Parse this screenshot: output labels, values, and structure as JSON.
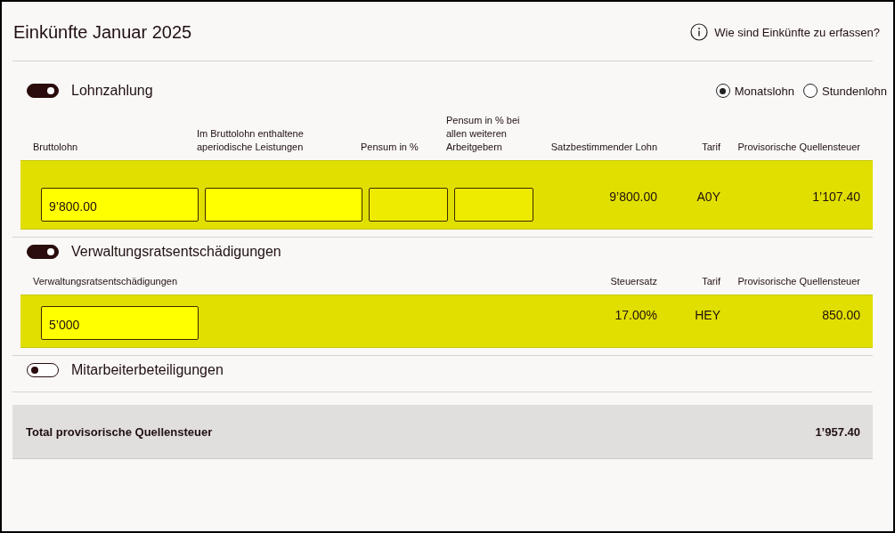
{
  "header": {
    "title": "Einkünfte Januar 2025",
    "help_link": "Wie sind Einkünfte zu erfassen?"
  },
  "sections": [
    {
      "title": "Lohnzahlung",
      "on": true,
      "radios": [
        {
          "label": "Monatslohn",
          "selected": true
        },
        {
          "label": "Stundenlohn",
          "selected": false
        }
      ],
      "columns": [
        "Bruttolohn",
        "Im Bruttolohn enthaltene aperiodische Leistungen",
        "Pensum in %",
        "Pensum in % bei allen weiteren Arbeitgebern",
        "Satzbestimmender Lohn",
        "Tarif",
        "Provisorische Quellensteuer"
      ],
      "cells": [
        {
          "kind": "input",
          "value": "9’800.00",
          "highlighted": true
        },
        {
          "kind": "input",
          "highlighted": true
        },
        {
          "kind": "input",
          "highlighted": false
        },
        {
          "kind": "input",
          "highlighted": false
        },
        {
          "kind": "text",
          "value": "9’800.00"
        },
        {
          "kind": "text",
          "value": "A0Y"
        },
        {
          "kind": "text",
          "value": "1’107.40"
        }
      ]
    },
    {
      "title": "Verwaltungsratsentschädigungen",
      "on": true,
      "columns": [
        "Verwaltungsratsentschädigungen",
        "Steuersatz",
        "Tarif",
        "Provisorische Quellensteuer"
      ],
      "cells": [
        {
          "kind": "input",
          "value": "5’000",
          "highlighted": true
        },
        {
          "kind": "text",
          "value": "17.00%"
        },
        {
          "kind": "text",
          "value": "HEY"
        },
        {
          "kind": "text",
          "value": "850.00"
        }
      ]
    },
    {
      "title": "Mitarbeiterbeteiligungen",
      "on": false
    }
  ],
  "total": {
    "label": "Total provisorische Quellensteuer",
    "value": "1’957.40"
  }
}
